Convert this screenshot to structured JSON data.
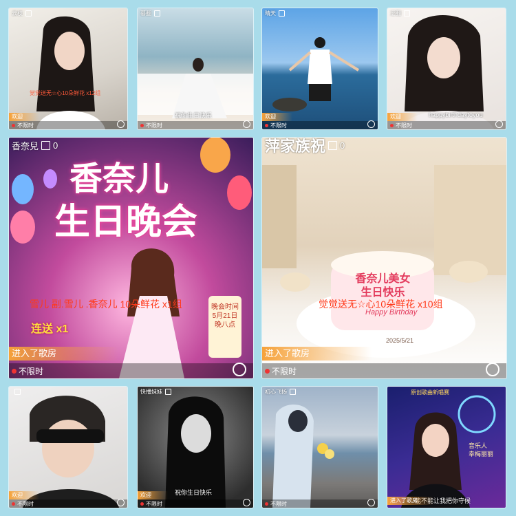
{
  "tiles": [
    {
      "top": "云枝",
      "count": "",
      "badge": "欢迎",
      "footer": "不限时",
      "caption": "",
      "gift": "觉觉送无☆心10朵鲜花 x12组"
    },
    {
      "top": "暮翻",
      "count": "",
      "badge": "",
      "footer": "不限时",
      "caption": "祝你生日快乐",
      "gift": ""
    },
    {
      "top": "晴天",
      "count": "",
      "badge": "欢迎",
      "footer": "不限时",
      "caption": "",
      "gift": ""
    },
    {
      "top": "涩翻",
      "count": "",
      "badge": "欢迎",
      "footer": "不限时",
      "caption": "happybirthdaytoyou",
      "gift": ""
    },
    {
      "top": "香奈兒",
      "count": "0",
      "badge": "进入了歌房",
      "footer": "不限时",
      "caption": "",
      "gift": "雪儿  副.雪儿  .香奈儿 10朵鲜花 x1组",
      "headline1": "香奈儿",
      "headline2": "生日晚会",
      "combo": "连送 x1",
      "candle": "晚会时间\n5月21日\n晚八点"
    },
    {
      "top": "萍家族祝",
      "count": "0",
      "badge": "进入了歌房",
      "footer": "不限时",
      "caption": "",
      "gift": "觉觉送无☆心10朵鲜花 x10组",
      "cake_text": "香奈儿美女\n生日快乐",
      "cake_sub": "Happy Birthday",
      "cake_date": "2025/5/21"
    },
    {
      "top": "",
      "count": "",
      "badge": "欢迎",
      "footer": "不限时",
      "caption": "",
      "gift": ""
    },
    {
      "top": "快播妹妹",
      "count": "",
      "badge": "欢迎",
      "footer": "不限时",
      "caption": "祝你生日快乐",
      "gift": ""
    },
    {
      "top": "初心飞扬",
      "count": "",
      "badge": "",
      "footer": "不限时",
      "caption": "",
      "gift": ""
    },
    {
      "top": "",
      "count": "",
      "badge": "进入了歌房",
      "footer": "",
      "caption": "能不能让我把你守候",
      "gift": "",
      "poster_title": "原创歌曲新唱赛",
      "poster_name": "音乐人\n幸梅丽丽"
    }
  ],
  "colors": {
    "background": "#a9dcea",
    "badge": "#f6a23a",
    "gift": "#ff5a3a"
  }
}
